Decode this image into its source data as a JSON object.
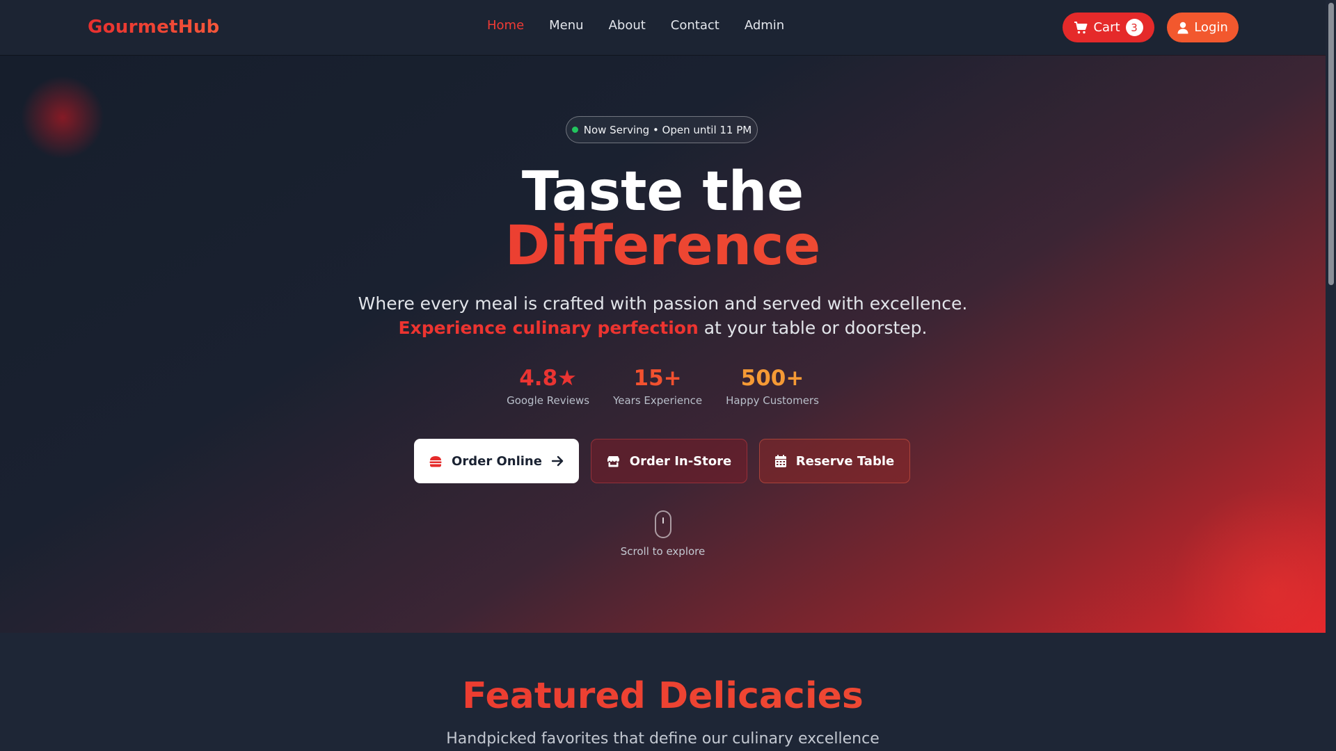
{
  "nav": {
    "logo": "GourmetHub",
    "links": [
      "Home",
      "Menu",
      "About",
      "Contact",
      "Admin"
    ],
    "active_link": "Home",
    "cart_label": "Cart",
    "cart_count": "3",
    "login_label": "Login"
  },
  "hero": {
    "status": "Now Serving • Open until 11 PM",
    "title_line1": "Taste the",
    "title_line2": "Difference",
    "subtitle_line1": "Where every meal is crafted with passion and served with excellence.",
    "subtitle_accent": "Experience culinary perfection",
    "subtitle_rest": " at your table or doorstep.",
    "stats": [
      {
        "value": "4.8★",
        "label": "Google Reviews"
      },
      {
        "value": "15+",
        "label": "Years Experience"
      },
      {
        "value": "500+",
        "label": "Happy Customers"
      }
    ],
    "buttons": {
      "order_online": "Order Online",
      "order_instore": "Order In-Store",
      "reserve": "Reserve Table"
    },
    "scroll_hint": "Scroll to explore"
  },
  "featured": {
    "title": "Featured Delicacies",
    "subtitle": "Handpicked favorites that define our culinary excellence"
  },
  "colors": {
    "brand_red": "#e52a2a",
    "brand_orange": "#f2582e",
    "status_green": "#22c55e",
    "nav_bg": "#1c2433"
  },
  "icons": {
    "cart": "shopping-cart-icon",
    "login": "user-icon",
    "order_online": "burger-icon",
    "order_online_arrow": "arrow-right-icon",
    "order_instore": "store-icon",
    "reserve": "calendar-icon",
    "scroll": "mouse-icon"
  }
}
